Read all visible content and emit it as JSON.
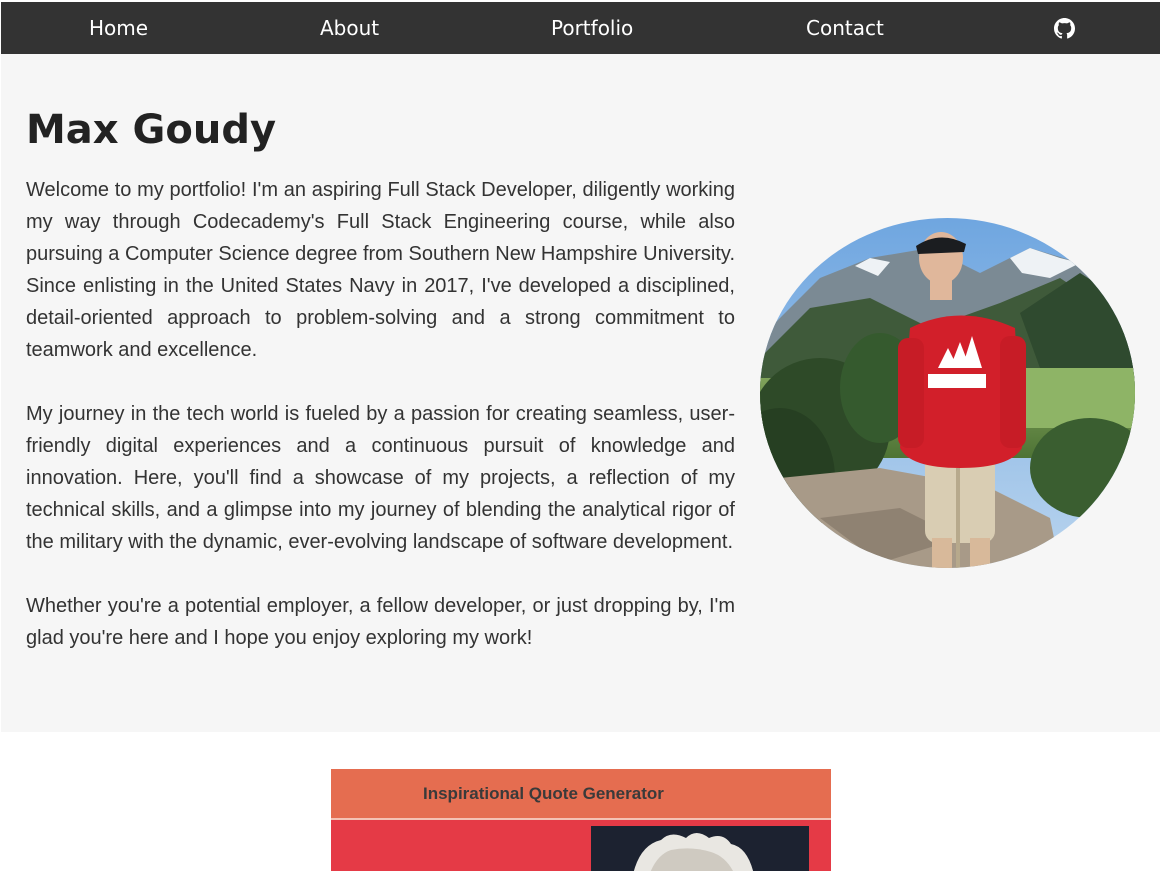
{
  "nav": {
    "home": "Home",
    "about": "About",
    "portfolio": "Portfolio",
    "contact": "Contact",
    "github_icon": "github-icon"
  },
  "about": {
    "name": "Max Goudy",
    "paragraphs": [
      "Welcome to my portfolio! I'm an aspiring Full Stack Developer, diligently working my way through Codecademy's Full Stack Engineering course, while also pursuing a Computer Science degree from Southern New Hampshire University. Since enlisting in the United States Navy in 2017, I've developed a disciplined, detail-oriented approach to problem-solving and a strong commitment to teamwork and excellence.",
      "My journey in the tech world is fueled by a passion for creating seamless, user-friendly digital experiences and a continuous pursuit of knowledge and innovation. Here, you'll find a showcase of my projects, a reflection of my technical skills, and a glimpse into my journey of blending the analytical rigor of the military with the dynamic, ever-evolving landscape of software development.",
      "Whether you're a potential employer, a fellow developer, or just dropping by, I'm glad you're here and I hope you enjoy exploring my work!"
    ]
  },
  "portfolio": {
    "first_project_title": "Inspirational Quote Generator"
  },
  "colors": {
    "nav_bg": "#333333",
    "section_bg": "#f6f6f6",
    "project_header": "#e56d50",
    "project_body": "#e53a46"
  }
}
